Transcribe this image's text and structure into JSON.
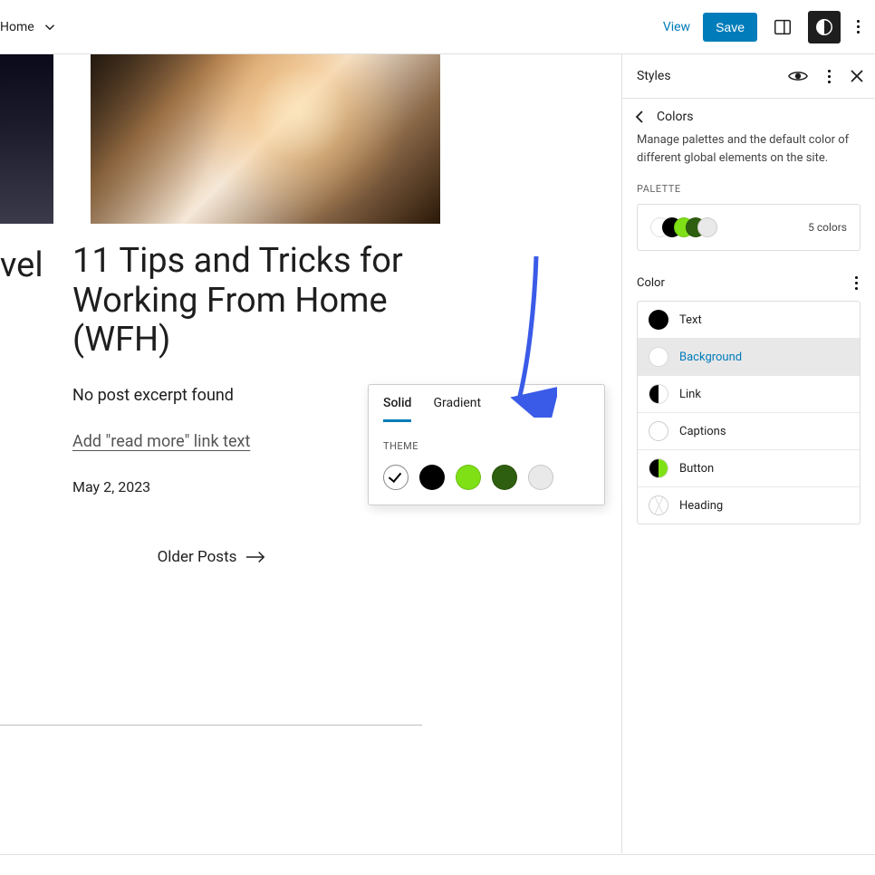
{
  "header": {
    "home": "Home",
    "view": "View",
    "save": "Save"
  },
  "post_left_title_fragment": "vel",
  "post": {
    "title": "11 Tips and Tricks for Working From Home (WFH)",
    "excerpt": "No post excerpt found",
    "read_more": "Add \"read more\" link text",
    "date": "May 2, 2023"
  },
  "older_posts": "Older Posts",
  "popover": {
    "tabs": {
      "solid": "Solid",
      "gradient": "Gradient"
    },
    "theme_label": "THEME",
    "swatches": [
      "#ffffff",
      "#000000",
      "#7EE015",
      "#2E5E0F",
      "#E9E9E9"
    ]
  },
  "sidebar": {
    "title": "Styles",
    "colors_title": "Colors",
    "colors_desc": "Manage palettes and the default color of different global elements on the site.",
    "palette_label": "PALETTE",
    "palette_count": "5 colors",
    "palette_colors": [
      "#ffffff",
      "#000000",
      "#7EE015",
      "#2E5E0F",
      "#E9E9E9"
    ],
    "color_section": "Color",
    "items": [
      {
        "label": "Text"
      },
      {
        "label": "Background"
      },
      {
        "label": "Link"
      },
      {
        "label": "Captions"
      },
      {
        "label": "Button"
      },
      {
        "label": "Heading"
      }
    ]
  }
}
